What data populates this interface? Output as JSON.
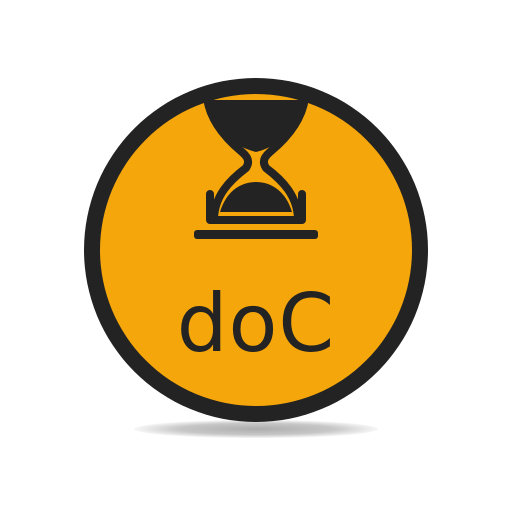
{
  "logo": {
    "text": "doC",
    "ring_color": "#232323",
    "fill_color": "#F5A60A",
    "text_color": "#232323",
    "icon": "hourglass-icon"
  }
}
